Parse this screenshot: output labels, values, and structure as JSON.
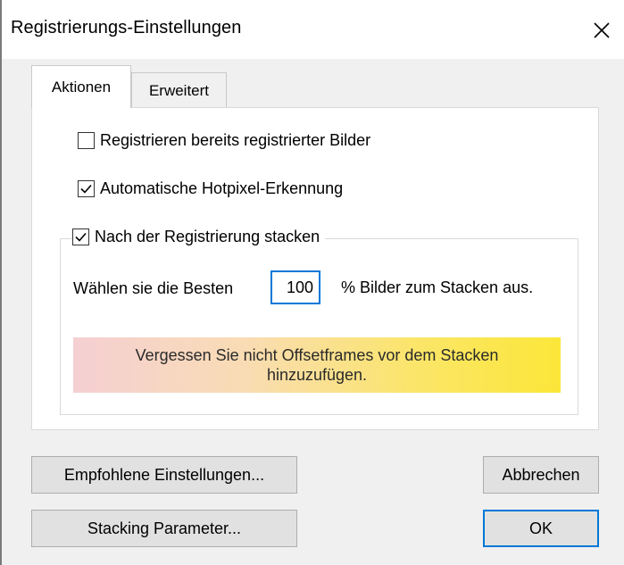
{
  "window": {
    "title": "Registrierungs-Einstellungen",
    "close_icon": "close-icon",
    "close_glyph": "✕"
  },
  "tabs": [
    {
      "label": "Aktionen",
      "active": true
    },
    {
      "label": "Erweitert",
      "active": false
    }
  ],
  "actions": {
    "register_already_registered": {
      "label": "Registrieren bereits registrierter Bilder",
      "checked": false
    },
    "auto_hotpixel": {
      "label": "Automatische Hotpixel-Erkennung",
      "checked": true
    },
    "stack_after_register": {
      "label": "Nach der Registrierung stacken",
      "checked": true
    },
    "best_percent": {
      "prefix": "Wählen sie die Besten",
      "value": "100",
      "suffix": "% Bilder zum Stacken aus."
    },
    "warning": "Vergessen Sie nicht Offsetframes vor dem Stacken hinzuzufügen."
  },
  "buttons": {
    "recommended": "Empfohlene Einstellungen...",
    "stacking_params": "Stacking Parameter...",
    "cancel": "Abbrechen",
    "ok": "OK"
  },
  "colors": {
    "accent": "#0078d7",
    "warning_gradient_start": "#f5cfd3",
    "warning_gradient_end": "#fbe739"
  }
}
